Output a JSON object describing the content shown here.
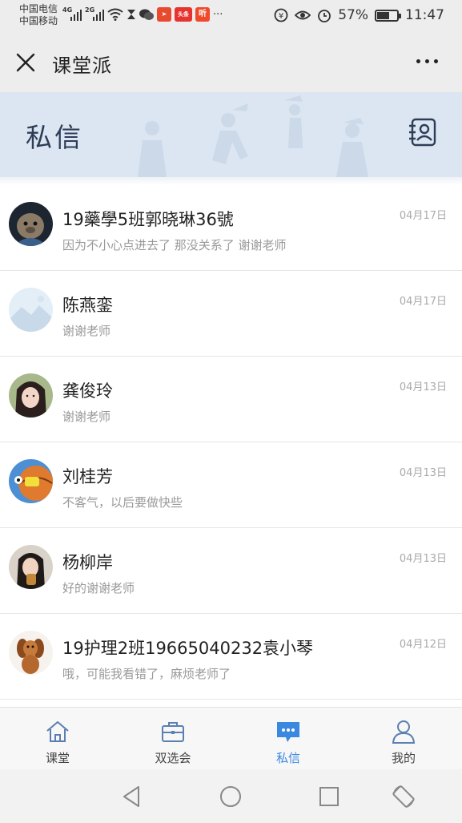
{
  "status_bar": {
    "carrier_1": "中国电信",
    "carrier_2": "中国移动",
    "net_1": "4G",
    "net_2": "2G",
    "badge_toutiao": "头条",
    "badge_ting": "听",
    "more_dots": "···",
    "battery": "57%",
    "time": "11:47"
  },
  "title_bar": {
    "title": "课堂派"
  },
  "banner": {
    "title": "私信"
  },
  "messages": [
    {
      "name": "19藥學5班郭晓琳36號",
      "preview": "因为不小心点进去了 那没关系了 谢谢老师",
      "date": "04月17日",
      "avatar": "alpaca"
    },
    {
      "name": "陈燕銮",
      "preview": "谢谢老师",
      "date": "04月17日",
      "avatar": "landscape"
    },
    {
      "name": "龚俊玲",
      "preview": "谢谢老师",
      "date": "04月13日",
      "avatar": "girl"
    },
    {
      "name": "刘桂芳",
      "preview": "不客气，以后要做快些",
      "date": "04月13日",
      "avatar": "cartoon"
    },
    {
      "name": "杨柳岸",
      "preview": "好的谢谢老师",
      "date": "04月13日",
      "avatar": "woman"
    },
    {
      "name": "19护理2班19665040232袁小琴",
      "preview": "哦，可能我看错了，麻烦老师了",
      "date": "04月12日",
      "avatar": "dog"
    }
  ],
  "tabs": [
    {
      "label": "课堂",
      "icon": "home-icon",
      "active": false
    },
    {
      "label": "双选会",
      "icon": "briefcase-icon",
      "active": false
    },
    {
      "label": "私信",
      "icon": "chat-bubble-icon",
      "active": true
    },
    {
      "label": "我的",
      "icon": "person-icon",
      "active": false
    }
  ],
  "colors": {
    "accent": "#3b88e0",
    "banner_bg": "#dbe6f2",
    "banner_text": "#2e3d57"
  }
}
